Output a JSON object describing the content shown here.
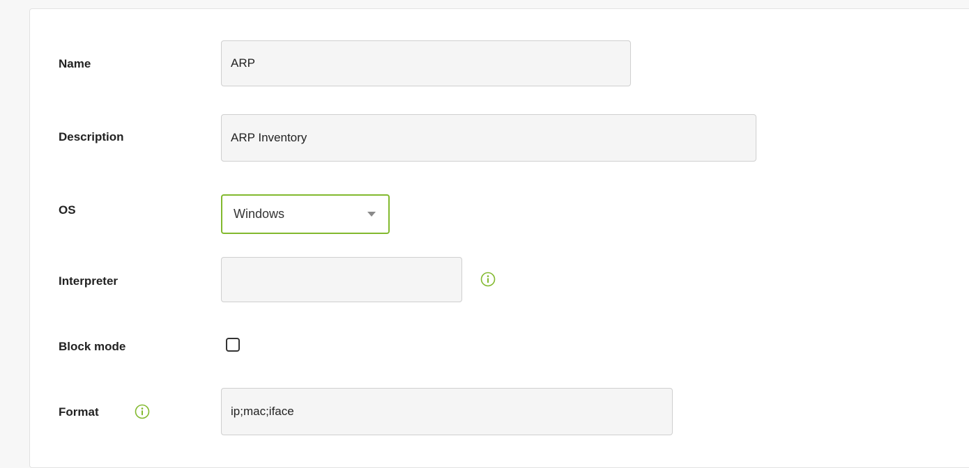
{
  "form": {
    "name": {
      "label": "Name",
      "value": "ARP"
    },
    "description": {
      "label": "Description",
      "value": "ARP Inventory"
    },
    "os": {
      "label": "OS",
      "selected": "Windows"
    },
    "interpreter": {
      "label": "Interpreter",
      "value": ""
    },
    "block_mode": {
      "label": "Block mode",
      "checked": false
    },
    "format": {
      "label": "Format",
      "value": "ip;mac;iface"
    }
  },
  "colors": {
    "accent": "#82b92e",
    "field_bg": "#f5f5f5",
    "field_border": "#cfcfcf"
  },
  "icons": {
    "info": "info-circle-icon",
    "dropdown": "chevron-down-icon"
  }
}
